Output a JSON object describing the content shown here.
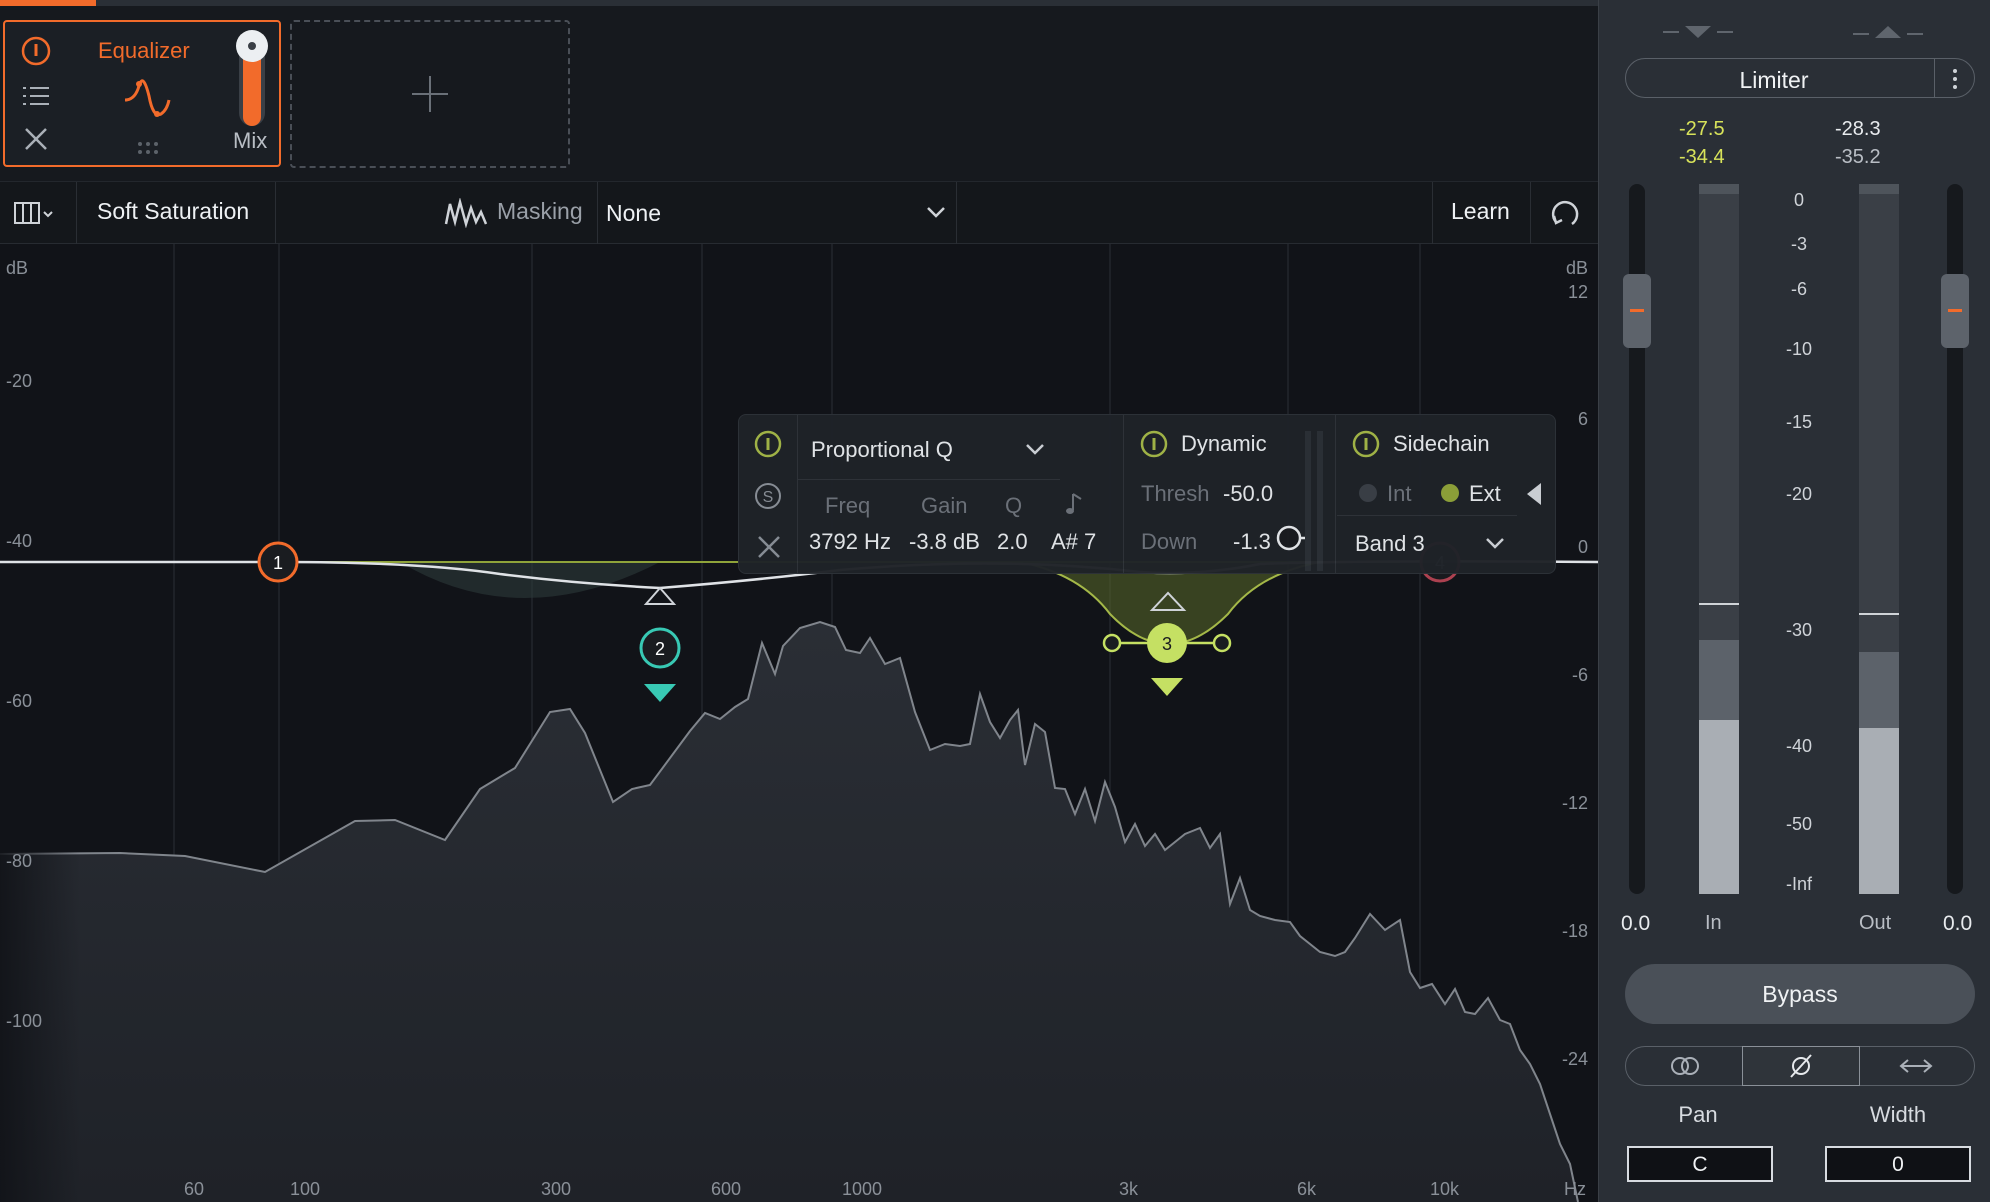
{
  "colors": {
    "accent": "#f26b2b",
    "band_green": "#c5e063",
    "band_teal": "#38c9b4",
    "band_red": "#c84a5a",
    "yellow_readout": "#d8e35a"
  },
  "module": {
    "title": "Equalizer",
    "mix_label": "Mix",
    "icons": [
      "power-icon",
      "list-icon",
      "close-icon",
      "eq-curve-icon",
      "drag-handle-icon"
    ],
    "mix_level": 0.85
  },
  "add_module": {
    "icon": "plus-icon"
  },
  "toolbar": {
    "preset_name": "Soft Saturation",
    "masking_label": "Masking",
    "masking_value": "None",
    "learn_label": "Learn",
    "icons": [
      "view-menu-icon",
      "masking-icon",
      "chevron-down-icon",
      "rotate-icon"
    ]
  },
  "eq": {
    "left_db_label": "dB",
    "right_db_label": "dB",
    "left_ticks": [
      "-20",
      "-40",
      "-60",
      "-80",
      "-100"
    ],
    "right_ticks": [
      "12",
      "6",
      "0",
      "-6",
      "-12",
      "-18",
      "-24"
    ],
    "freq_ticks": [
      "60",
      "100",
      "300",
      "600",
      "1000",
      "3k",
      "6k",
      "10k",
      "Hz"
    ],
    "nodes": [
      "1",
      "2",
      "3",
      "4"
    ]
  },
  "band_panel": {
    "filter_type": "Proportional Q",
    "freq_label": "Freq",
    "gain_label": "Gain",
    "q_label": "Q",
    "freq": "3792 Hz",
    "gain": "-3.8 dB",
    "q": "2.0",
    "note": "A# 7",
    "dynamic_label": "Dynamic",
    "thresh_label": "Thresh",
    "thresh": "-50.0",
    "down_label": "Down",
    "down": "-1.3",
    "sidechain_label": "Sidechain",
    "int_label": "Int",
    "ext_label": "Ext",
    "band_select": "Band 3",
    "icons": [
      "power-icon",
      "solo-icon",
      "close-icon",
      "note-icon",
      "chevron-down-icon",
      "collapse-left-icon"
    ]
  },
  "limiter": {
    "title": "Limiter",
    "in_peak": "-27.5",
    "in_rms": "-34.4",
    "out_peak": "-28.3",
    "out_rms": "-35.2",
    "scale": [
      "0",
      "-3",
      "-6",
      "-10",
      "-15",
      "-20",
      "-30",
      "-40",
      "-50",
      "-Inf"
    ],
    "in_gain": "0.0",
    "out_gain": "0.0",
    "in_label": "In",
    "out_label": "Out",
    "bypass_label": "Bypass",
    "pan_label": "Pan",
    "width_label": "Width",
    "pan_value": "C",
    "width_value": "0",
    "icons": [
      "more-options-icon",
      "stereo-icon",
      "phase-icon",
      "swap-icon",
      "collapse-down-icon",
      "collapse-up-icon"
    ]
  }
}
